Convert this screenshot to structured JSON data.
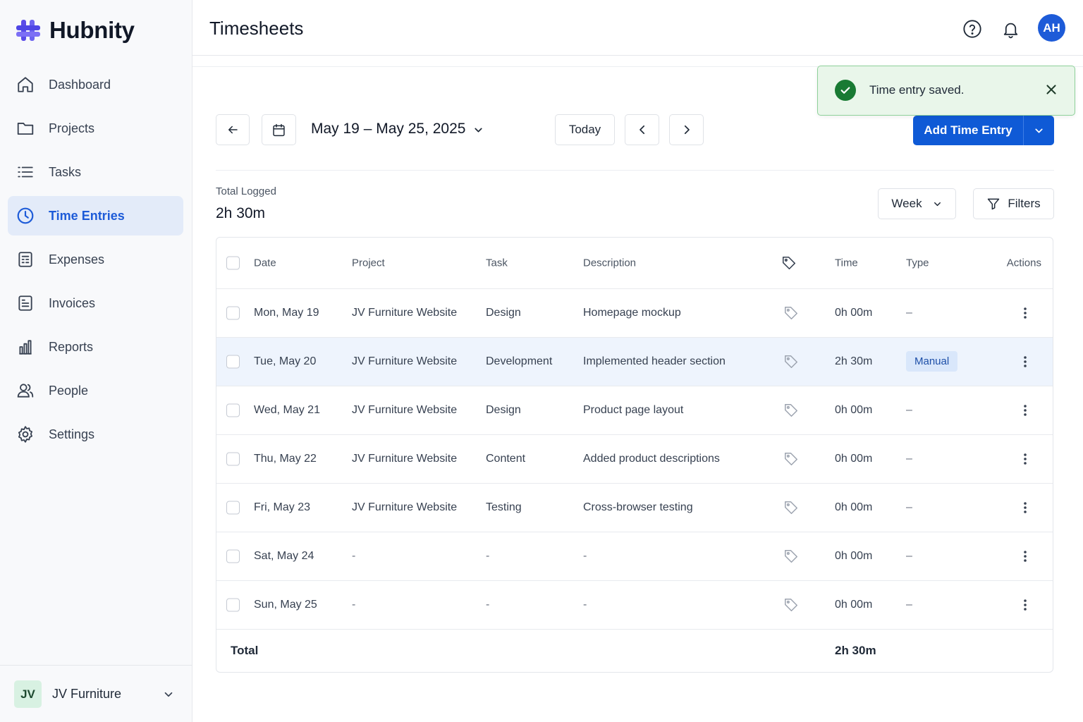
{
  "app": {
    "name": "Hubnity"
  },
  "sidebar": {
    "items": [
      {
        "label": "Dashboard",
        "icon": "home-icon",
        "active": false
      },
      {
        "label": "Projects",
        "icon": "folder-icon",
        "active": false
      },
      {
        "label": "Tasks",
        "icon": "list-icon",
        "active": false
      },
      {
        "label": "Time Entries",
        "icon": "clock-icon",
        "active": true
      },
      {
        "label": "Expenses",
        "icon": "receipt-icon",
        "active": false
      },
      {
        "label": "Invoices",
        "icon": "invoice-icon",
        "active": false
      },
      {
        "label": "Reports",
        "icon": "bar-chart-icon",
        "active": false
      },
      {
        "label": "People",
        "icon": "users-icon",
        "active": false
      },
      {
        "label": "Settings",
        "icon": "gear-icon",
        "active": false
      }
    ],
    "workspace": {
      "initials": "JV",
      "name": "JV Furniture"
    }
  },
  "header": {
    "title": "Timesheets",
    "user_initials": "AH"
  },
  "toast": {
    "message": "Time entry saved."
  },
  "toolbar": {
    "date_range": "May 19 – May 25, 2025",
    "today_label": "Today",
    "add_label": "Add Time Entry"
  },
  "summary": {
    "total_label": "Total Logged",
    "total_value": "2h 30m",
    "period_label": "Week",
    "filters_label": "Filters"
  },
  "table": {
    "columns": {
      "date": "Date",
      "project": "Project",
      "task": "Task",
      "description": "Description",
      "time": "Time",
      "type": "Type",
      "actions": "Actions"
    },
    "rows": [
      {
        "date": "Mon, May 19",
        "project": "JV Furniture Website",
        "task": "Design",
        "description": "Homepage mockup",
        "time": "0h 00m",
        "type": "–"
      },
      {
        "date": "Tue, May 20",
        "project": "JV Furniture Website",
        "task": "Development",
        "description": "Implemented header section",
        "time": "2h 30m",
        "type": "Manual"
      },
      {
        "date": "Wed, May 21",
        "project": "JV Furniture Website",
        "task": "Design",
        "description": "Product page layout",
        "time": "0h 00m",
        "type": "–"
      },
      {
        "date": "Thu, May 22",
        "project": "JV Furniture Website",
        "task": "Content",
        "description": "Added product descriptions",
        "time": "0h 00m",
        "type": "–"
      },
      {
        "date": "Fri, May 23",
        "project": "JV Furniture Website",
        "task": "Testing",
        "description": "Cross-browser testing",
        "time": "0h 00m",
        "type": "–"
      },
      {
        "date": "Sat, May 24",
        "project": "-",
        "task": "-",
        "description": "-",
        "time": "0h 00m",
        "type": "–"
      },
      {
        "date": "Sun, May 25",
        "project": "-",
        "task": "-",
        "description": "-",
        "time": "0h 00m",
        "type": "–"
      }
    ],
    "footer": {
      "label": "Total",
      "time": "2h 30m"
    }
  },
  "colors": {
    "accent": "#0f5ad6",
    "active_bg": "#e3ebf9",
    "success": "#197a33",
    "badge_bg": "#d9e7fb"
  }
}
